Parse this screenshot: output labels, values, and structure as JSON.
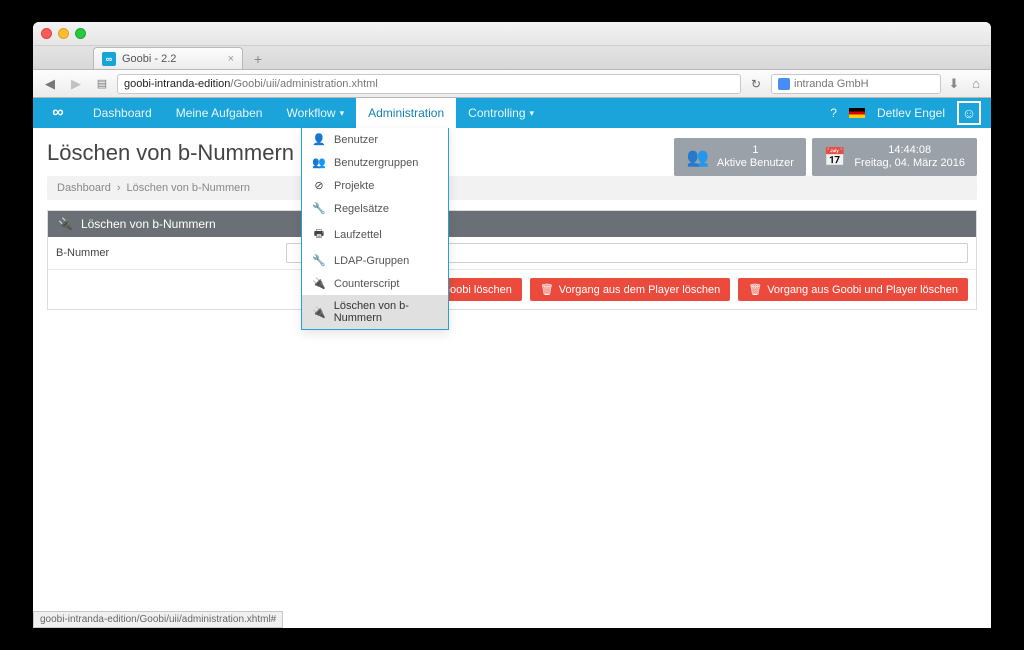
{
  "browser": {
    "tab_title": "Goobi - 2.2",
    "url_host": "goobi-intranda-edition",
    "url_path": "/Goobi/uii/administration.xhtml",
    "search_placeholder": "intranda GmbH",
    "status_url": "goobi-intranda-edition/Goobi/uii/administration.xhtml#"
  },
  "nav": {
    "items": [
      "Dashboard",
      "Meine Aufgaben",
      "Workflow",
      "Administration",
      "Controlling"
    ],
    "user": "Detlev Engel"
  },
  "page": {
    "title": "Löschen von b-Nummern",
    "breadcrumbs": [
      "Dashboard",
      "Löschen von b-Nummern"
    ],
    "panel_title": "Löschen von b-Nummern",
    "field_label": "B-Nummer"
  },
  "infoboxes": {
    "users_count": "1",
    "users_label": "Aktive Benutzer",
    "time": "14:44:08",
    "date": "Freitag, 04. März 2016"
  },
  "dropdown": [
    {
      "icon": "user",
      "label": "Benutzer"
    },
    {
      "icon": "users",
      "label": "Benutzergruppen"
    },
    {
      "icon": "ban",
      "label": "Projekte"
    },
    {
      "icon": "wrench",
      "label": "Regelsätze"
    },
    {
      "icon": "print",
      "label": "Laufzettel"
    },
    {
      "icon": "wrench",
      "label": "LDAP-Gruppen"
    },
    {
      "icon": "plug",
      "label": "Counterscript"
    },
    {
      "icon": "plug",
      "label": "Löschen von b-Nummern",
      "selected": true
    }
  ],
  "buttons": {
    "delete_goobi": "Vorgang aus Goobi löschen",
    "delete_player": "Vorgang aus dem Player löschen",
    "delete_both": "Vorgang aus Goobi und Player löschen"
  }
}
